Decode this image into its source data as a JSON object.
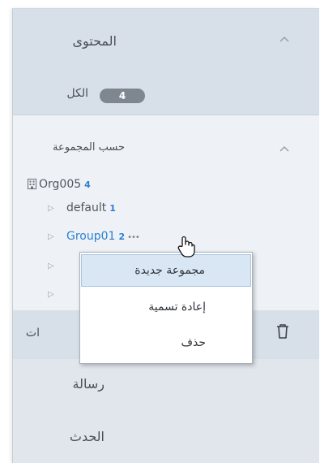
{
  "content_section": {
    "title": "المحتوى",
    "collapse_icon": "chevron-up-icon"
  },
  "all_filter": {
    "label": "الكل",
    "count": "4"
  },
  "group_section": {
    "title": "حسب المجموعة",
    "collapse_icon": "chevron-up-icon"
  },
  "tree": {
    "org": {
      "name": "Org005",
      "count": "4",
      "icon": "building-icon"
    },
    "items": [
      {
        "name": "default",
        "count": "1"
      },
      {
        "name": "Group01",
        "count": "2",
        "more": "•••"
      }
    ]
  },
  "context_menu": {
    "items": [
      "مجموعة جديدة",
      "إعادة تسمية",
      "حذف"
    ],
    "highlighted": 0
  },
  "partial_row": {
    "label": "ات"
  },
  "nav": [
    {
      "label": "رسالة"
    },
    {
      "label": "الحدث"
    }
  ],
  "colors": {
    "accent": "#2d7fd2",
    "badge": "#7e868f"
  }
}
